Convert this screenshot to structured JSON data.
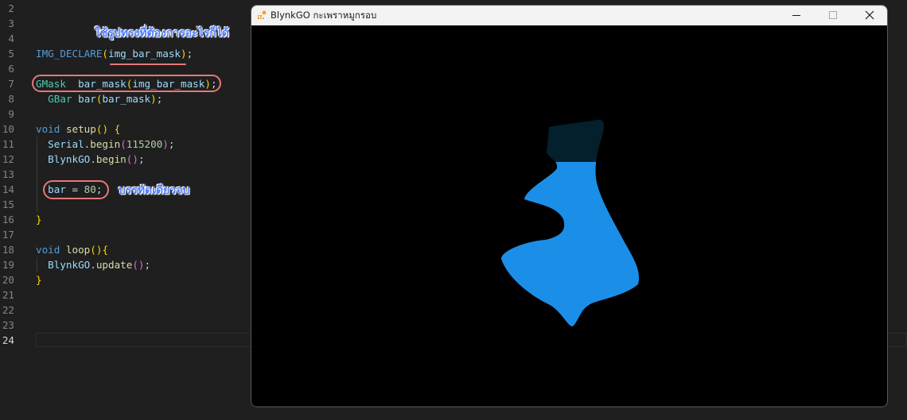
{
  "editor": {
    "lines": [
      {
        "n": "2",
        "tokens": []
      },
      {
        "n": "3",
        "tokens": []
      },
      {
        "n": "4",
        "tokens": []
      },
      {
        "n": "5",
        "tokens": [
          {
            "t": "IMG_DECLARE",
            "c": "mac"
          },
          {
            "t": "(",
            "c": "p1"
          },
          {
            "t": "img_bar_mask",
            "c": "var"
          },
          {
            "t": ")",
            "c": "p1"
          },
          {
            "t": ";",
            "c": "txt"
          }
        ]
      },
      {
        "n": "6",
        "tokens": []
      },
      {
        "n": "7",
        "tokens": [
          {
            "t": "GMask",
            "c": "ty"
          },
          {
            "t": "  ",
            "c": "txt"
          },
          {
            "t": "bar_mask",
            "c": "var"
          },
          {
            "t": "(",
            "c": "p1"
          },
          {
            "t": "img_bar_mask",
            "c": "var"
          },
          {
            "t": ")",
            "c": "p1"
          },
          {
            "t": ";",
            "c": "txt"
          }
        ]
      },
      {
        "n": "8",
        "tokens": [
          {
            "t": "  ",
            "c": "txt"
          },
          {
            "t": "GBar",
            "c": "ty"
          },
          {
            "t": " ",
            "c": "txt"
          },
          {
            "t": "bar",
            "c": "var"
          },
          {
            "t": "(",
            "c": "p1"
          },
          {
            "t": "bar_mask",
            "c": "var"
          },
          {
            "t": ")",
            "c": "p1"
          },
          {
            "t": ";",
            "c": "txt"
          }
        ]
      },
      {
        "n": "9",
        "tokens": []
      },
      {
        "n": "10",
        "tokens": [
          {
            "t": "void",
            "c": "kw"
          },
          {
            "t": " ",
            "c": "txt"
          },
          {
            "t": "setup",
            "c": "fn"
          },
          {
            "t": "()",
            "c": "p1"
          },
          {
            "t": " ",
            "c": "txt"
          },
          {
            "t": "{",
            "c": "p1"
          }
        ]
      },
      {
        "n": "11",
        "tokens": [
          {
            "t": "  ",
            "c": "txt"
          },
          {
            "t": "Serial",
            "c": "var"
          },
          {
            "t": ".",
            "c": "txt"
          },
          {
            "t": "begin",
            "c": "fn"
          },
          {
            "t": "(",
            "c": "p2"
          },
          {
            "t": "115200",
            "c": "num"
          },
          {
            "t": ")",
            "c": "p2"
          },
          {
            "t": ";",
            "c": "txt"
          }
        ]
      },
      {
        "n": "12",
        "tokens": [
          {
            "t": "  ",
            "c": "txt"
          },
          {
            "t": "BlynkGO",
            "c": "var"
          },
          {
            "t": ".",
            "c": "txt"
          },
          {
            "t": "begin",
            "c": "fn"
          },
          {
            "t": "()",
            "c": "p2"
          },
          {
            "t": ";",
            "c": "txt"
          }
        ]
      },
      {
        "n": "13",
        "tokens": []
      },
      {
        "n": "14",
        "tokens": [
          {
            "t": "  ",
            "c": "txt"
          },
          {
            "t": "bar",
            "c": "var"
          },
          {
            "t": " = ",
            "c": "txt"
          },
          {
            "t": "80",
            "c": "num"
          },
          {
            "t": ";",
            "c": "txt"
          }
        ]
      },
      {
        "n": "15",
        "tokens": []
      },
      {
        "n": "16",
        "tokens": [
          {
            "t": "}",
            "c": "p1"
          }
        ]
      },
      {
        "n": "17",
        "tokens": []
      },
      {
        "n": "18",
        "tokens": [
          {
            "t": "void",
            "c": "kw"
          },
          {
            "t": " ",
            "c": "txt"
          },
          {
            "t": "loop",
            "c": "fn"
          },
          {
            "t": "()",
            "c": "p1"
          },
          {
            "t": "{",
            "c": "p1"
          }
        ]
      },
      {
        "n": "19",
        "tokens": [
          {
            "t": "  ",
            "c": "txt"
          },
          {
            "t": "BlynkGO",
            "c": "var"
          },
          {
            "t": ".",
            "c": "txt"
          },
          {
            "t": "update",
            "c": "fn"
          },
          {
            "t": "()",
            "c": "p2"
          },
          {
            "t": ";",
            "c": "txt"
          }
        ]
      },
      {
        "n": "20",
        "tokens": [
          {
            "t": "}",
            "c": "p1"
          }
        ]
      },
      {
        "n": "21",
        "tokens": []
      },
      {
        "n": "22",
        "tokens": []
      },
      {
        "n": "23",
        "tokens": []
      },
      {
        "n": "24",
        "tokens": [],
        "active": true
      }
    ]
  },
  "annotations": {
    "shape_note": "ใช้รูปทรงที่ต้องการอะไรก็ได้",
    "one_line_note": "บรรทัดเดียวจบ"
  },
  "window": {
    "title": "BlynkGO กะเพราหมูกรอบ",
    "icon": "blynkgo-app-icon",
    "controls": [
      "minimize-icon",
      "maximize-icon",
      "close-icon"
    ]
  },
  "bar_widget": {
    "value": 80,
    "fill_color": "#1b8fe8",
    "background_color": "#04202d"
  }
}
